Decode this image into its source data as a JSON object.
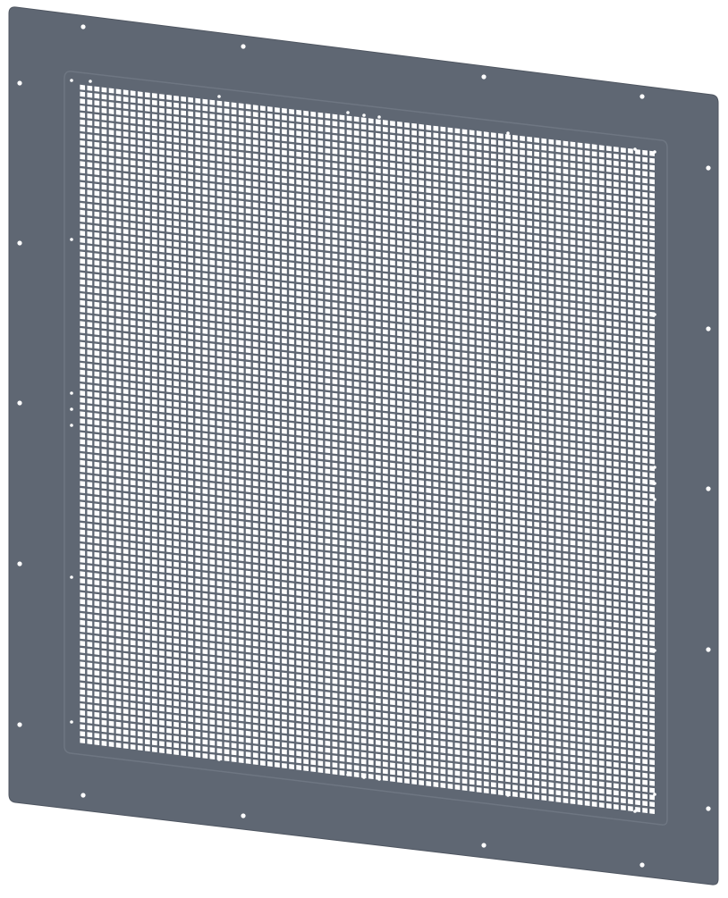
{
  "image": {
    "subject": "perforated-metal-panel",
    "colors": {
      "background": "#ffffff",
      "panel": "#5f6773",
      "panel_edge": "#4f5661",
      "recess_line": "#6e7682",
      "mesh_hole": "#ffffff"
    }
  }
}
